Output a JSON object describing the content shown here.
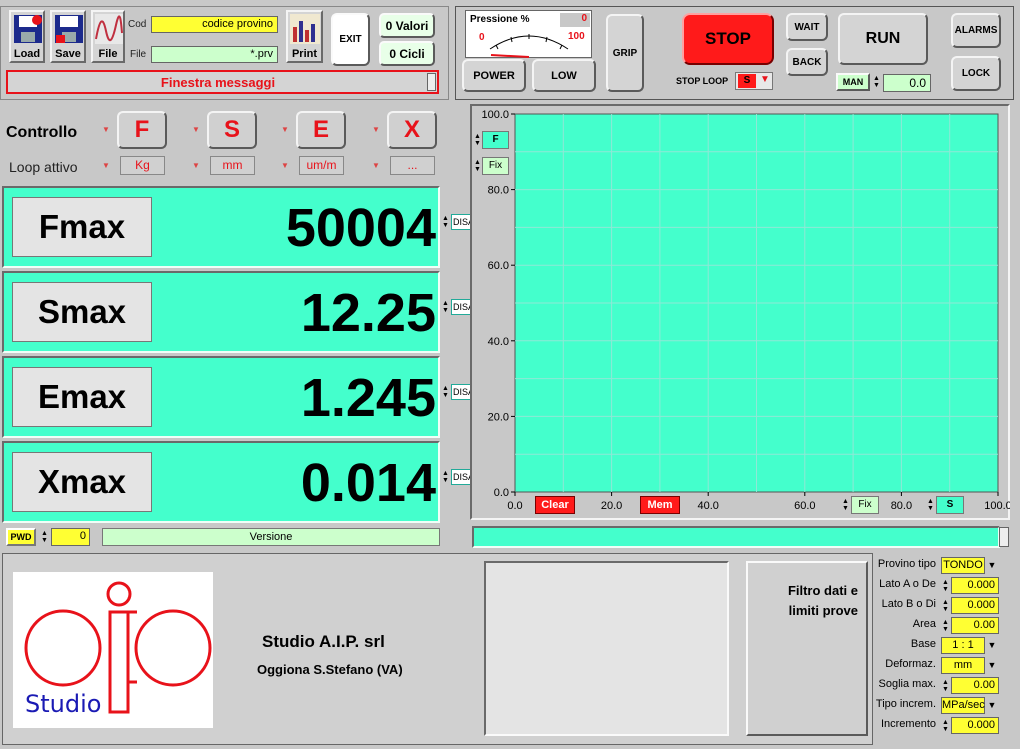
{
  "toolbar": {
    "load_label": "Load",
    "save_label": "Save",
    "file_label": "File",
    "cod_label": "Cod",
    "cod_value": "codice provino",
    "file_field_label": "File",
    "file_value": "*.prv",
    "print_label": "Print",
    "exit_label": "EXIT",
    "valori_label": "0 Valori",
    "cicli_label": "0 Cicli",
    "message_label": "Finestra messaggi"
  },
  "pressure": {
    "title": "Pressione %",
    "value": "0",
    "min": "0",
    "max": "100",
    "level": 0
  },
  "controls": {
    "grip_label": "GRIP",
    "power_label": "POWER",
    "low_label": "LOW",
    "stop_label": "STOP",
    "stop_loop_label": "STOP LOOP",
    "stop_loop_value": "S",
    "wait_label": "WAIT",
    "back_label": "BACK",
    "run_label": "RUN",
    "man_label": "MAN",
    "man_value": "0.0",
    "alarms_label": "ALARMS",
    "lock_label": "LOCK"
  },
  "controllo": {
    "title": "Controllo",
    "loop_label": "Loop attivo",
    "buttons": [
      "F",
      "S",
      "E",
      "X"
    ],
    "units": [
      "Kg",
      "mm",
      "um/m",
      "..."
    ]
  },
  "measurements": [
    {
      "label": "Fmax",
      "value": "50004",
      "toggle": "DISAB"
    },
    {
      "label": "Smax",
      "value": "12.25",
      "toggle": "DISAB"
    },
    {
      "label": "Emax",
      "value": "1.245",
      "toggle": "DISAB"
    },
    {
      "label": "Xmax",
      "value": "0.014",
      "toggle": "DISAB"
    }
  ],
  "footer_left": {
    "pwd_label": "PWD",
    "pwd_value": "0",
    "version_label": "Versione"
  },
  "chart_data": {
    "type": "line",
    "series": [],
    "xlim": [
      0,
      100
    ],
    "ylim": [
      0,
      100
    ],
    "xticks": [
      "0.0",
      "20.0",
      "40.0",
      "60.0",
      "80.0",
      "100.0"
    ],
    "yticks": [
      "0.0",
      "20.0",
      "40.0",
      "60.0",
      "80.0",
      "100.0"
    ],
    "grid": true,
    "y_channel": "F",
    "y_mode": "Fix",
    "x_channel": "S",
    "x_mode": "Fix",
    "clear_label": "Clear",
    "mem_label": "Mem",
    "plot_bg": "#44ffcc"
  },
  "company": {
    "logo_text": "Studio",
    "name": "Studio A.I.P. srl",
    "address": "Oggiona S.Stefano (VA)"
  },
  "filter_label": "Filtro dati  e limiti prove",
  "params": [
    {
      "label": "Provino tipo",
      "value": "TONDO",
      "kind": "dropdown"
    },
    {
      "label": "Lato A o De",
      "value": "0.000",
      "kind": "spin"
    },
    {
      "label": "Lato B o Di",
      "value": "0.000",
      "kind": "spin"
    },
    {
      "label": "Area",
      "value": "0.00",
      "kind": "spin"
    },
    {
      "label": "Base",
      "value": "1 : 1",
      "kind": "dropdown"
    },
    {
      "label": "Deformaz.",
      "value": "mm",
      "kind": "dropdown"
    },
    {
      "label": "Soglia max.",
      "value": "0.00",
      "kind": "spin"
    },
    {
      "label": "Tipo increm.",
      "value": "MPa/sec",
      "kind": "dropdown"
    },
    {
      "label": "Incremento",
      "value": "0.000",
      "kind": "spin"
    }
  ],
  "colors": {
    "accent_cyan": "#44ffcc",
    "stop_red": "#ff1a1a",
    "field_yellow": "#ffff33",
    "field_green": "#ccffcc",
    "logo_red": "#e8121a",
    "logo_blue": "#1a1ab4"
  }
}
